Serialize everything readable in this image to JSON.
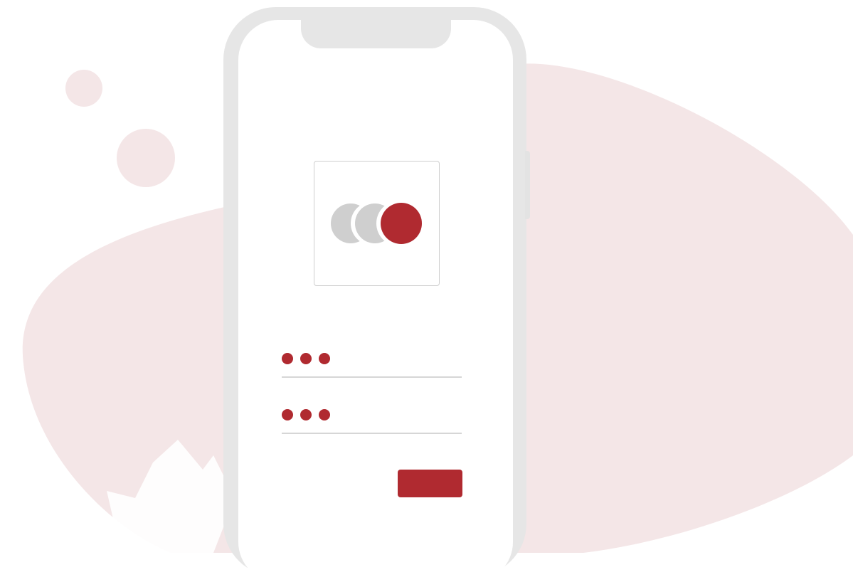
{
  "colors": {
    "accent": "#b02a30",
    "blob": "#f4e6e7",
    "phone_frame": "#e6e6e6",
    "logo_grey": "#cfcfcf",
    "underline": "#d6d6d6",
    "screen": "#ffffff"
  },
  "login_form": {
    "logo_icon": "three-overlapping-circles-icon",
    "username_field": {
      "masked_dots": 3
    },
    "password_field": {
      "masked_dots": 3
    },
    "submit_button": {
      "label": ""
    }
  }
}
